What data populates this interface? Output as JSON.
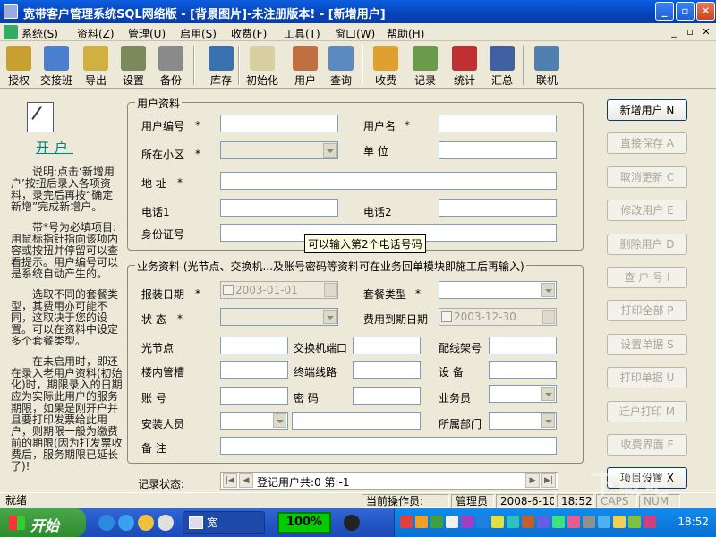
{
  "window": {
    "title": "宽带客户管理系统SQL网络版 - [背景图片]-未注册版本! - [新增用户]"
  },
  "menu": [
    "系统(S)",
    "资料(Z)",
    "管理(U)",
    "启用(S)",
    "收费(F)",
    "工具(T)",
    "窗口(W)",
    "帮助(H)"
  ],
  "toolbar": [
    {
      "label": "授权",
      "icon": "key-icon",
      "color": "#c8a030"
    },
    {
      "label": "交接班",
      "icon": "people-icon",
      "color": "#4a7fd0"
    },
    {
      "label": "导出",
      "icon": "broom-icon",
      "color": "#d0b040"
    },
    {
      "label": "设置",
      "icon": "gear-icon",
      "color": "#7a8a5a"
    },
    {
      "label": "备份",
      "icon": "database-icon",
      "color": "#8a8a8a"
    },
    {
      "label": "库存",
      "icon": "box-icon",
      "color": "#3a70b0"
    },
    {
      "label": "初始化",
      "icon": "notepad-icon",
      "color": "#d8d0a0"
    },
    {
      "label": "用户",
      "icon": "user-icon",
      "color": "#c07040"
    },
    {
      "label": "查询",
      "icon": "search-icon",
      "color": "#5a8ac0"
    },
    {
      "label": "收费",
      "icon": "coin-icon",
      "color": "#e0a030"
    },
    {
      "label": "记录",
      "icon": "gears-icon",
      "color": "#6a9a4a"
    },
    {
      "label": "统计",
      "icon": "chart-icon",
      "color": "#c03030"
    },
    {
      "label": "汇总",
      "icon": "calendar-icon",
      "color": "#4060a0"
    },
    {
      "label": "联机",
      "icon": "network-icon",
      "color": "#5080b0"
    }
  ],
  "left": {
    "title": "开户",
    "desc": [
      "说明:点击‘新增用户’按扭后录入各项资料，录完后再按“确定新增”完成新增户。",
      "带*号为必填项目:用鼠标指针指向该项内容或按扭并停留可以查看提示。用户编号可以是系统自动产生的。",
      "选取不同的套餐类型，其费用亦可能不同，这取决于您的设置。可以在资料中设定多个套餐类型。",
      "在未启用时，即还在录入老用户资料(初始化)时，期限录入的日期应为实际此用户的服务期限，如果是刚开户并且要打印发票给此用户，则期限一般为缴费前的期限(因为打发票收费后，服务期限已延长了)!"
    ]
  },
  "user_group": {
    "title": "用户资料",
    "user_no": "用户编号",
    "user_name": "用户名",
    "community": "所在小区",
    "unit": "单 位",
    "address": "地 址",
    "phone1": "电话1",
    "phone2": "电话2",
    "id_card": "身份证号",
    "star": "*"
  },
  "tooltip": "可以输入第2个电话号码",
  "biz_group": {
    "title": "业务资料 (光节点、交换机...及账号密码等资料可在业务回单模块即施工后再输入)",
    "install_date": "报装日期",
    "install_date_value": "2003-01-01",
    "package": "套餐类型",
    "status": "状 态",
    "expire": "费用到期日期",
    "expire_value": "2003-12-30",
    "optical_node": "光节点",
    "switch_port": "交换机端口",
    "rack": "配线架号",
    "trunk": "楼内管槽",
    "terminal_line": "终端线路",
    "device": "设 备",
    "account": "账 号",
    "password": "密 码",
    "salesman": "业务员",
    "installer": "安装人员",
    "department": "所属部门",
    "note": "备 注",
    "star": "*"
  },
  "buttons": [
    {
      "label": "新增用户 N",
      "enabled": true
    },
    {
      "label": "直接保存 A",
      "enabled": false
    },
    {
      "label": "取消更新 C",
      "enabled": false
    },
    {
      "label": "修改用户 E",
      "enabled": false
    },
    {
      "label": "删除用户 D",
      "enabled": false
    },
    {
      "label": "查 户 号 I",
      "enabled": false
    },
    {
      "label": "打印全部 P",
      "enabled": false
    },
    {
      "label": "设置单据 S",
      "enabled": false
    },
    {
      "label": "打印单据 U",
      "enabled": false
    },
    {
      "label": "迁户打印 M",
      "enabled": false
    },
    {
      "label": "收费界面 F",
      "enabled": false
    },
    {
      "label": "项目设置 X",
      "enabled": true
    }
  ],
  "nav": {
    "label": "记录状态:",
    "text": "登记用户共:0  第:-1"
  },
  "status": {
    "ready": "就绪",
    "operator_label": "当前操作员:",
    "operator": "管理员",
    "date": "2008-6-10",
    "time": "18:52",
    "caps": "CAPS",
    "num": "NUM"
  },
  "taskbar": {
    "start": "开始",
    "task": "宽",
    "percent": "100%",
    "clock": "18:52"
  },
  "watermark": "下载吧"
}
